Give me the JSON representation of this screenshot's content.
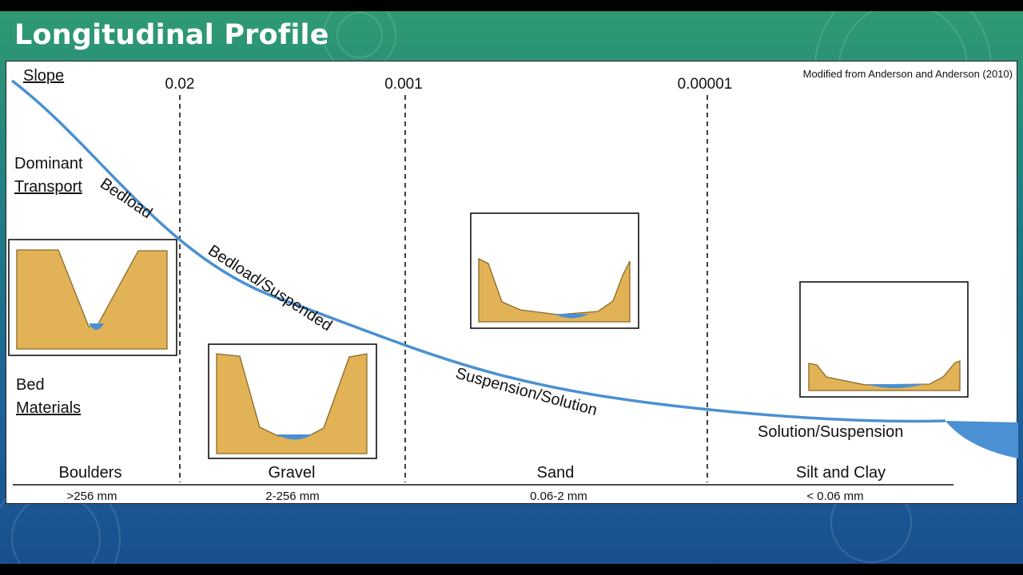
{
  "slide": {
    "title": "Longitudinal Profile",
    "credit": "Modified from Anderson and Anderson (2010)"
  },
  "row_labels": {
    "slope": "Slope",
    "dominant_line1": "Dominant",
    "dominant_line2": "Transport",
    "bed_line1": "Bed",
    "bed_line2": "Materials"
  },
  "slope_values": [
    "0.02",
    "0.001",
    "0.00001"
  ],
  "transport_labels": [
    "Bedload",
    "Bedload/Suspended",
    "Suspension/Solution",
    "Solution/Suspension"
  ],
  "bed_materials": [
    {
      "name": "Boulders",
      "size": ">256 mm"
    },
    {
      "name": "Gravel",
      "size": "2-256 mm"
    },
    {
      "name": "Sand",
      "size": "0.06-2 mm"
    },
    {
      "name": "Silt and Clay",
      "size": "< 0.06 mm"
    }
  ],
  "colors": {
    "profile_line": "#4a90d2",
    "sediment": "#e2b257",
    "sediment_edge": "#8a6a2a",
    "water": "#4a90d2"
  },
  "icons": [
    "channel-cross-section-boulders",
    "channel-cross-section-gravel",
    "channel-cross-section-sand",
    "channel-cross-section-silt-clay"
  ]
}
